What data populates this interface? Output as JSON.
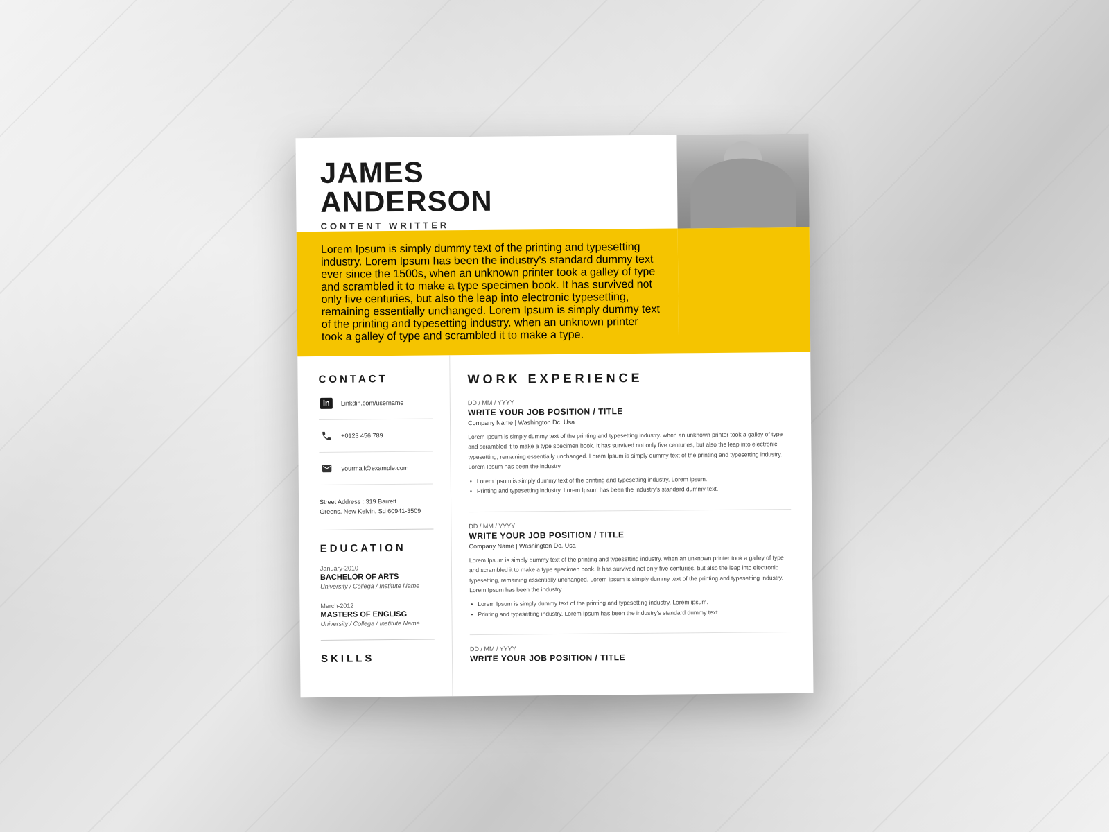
{
  "resume": {
    "name_line1": "JAMES",
    "name_line2": "ANDERSON",
    "job_title": "CONTENT WRITTER",
    "bio": "Lorem Ipsum is simply dummy text of the printing and typesetting industry. Lorem Ipsum has been the industry's standard dummy text ever since the 1500s, when an unknown printer took a galley of type and scrambled it to make a type specimen book. It has survived not only five centuries, but also the leap into electronic typesetting, remaining essentially unchanged. Lorem Ipsum is simply dummy text of the printing and typesetting industry. when an unknown printer took a galley of type and scrambled it to make a type.",
    "contact": {
      "section_label": "CONTACT",
      "linkedin": "Linkdin.com/username",
      "phone": "+0123 456 789",
      "email": "yourmail@example.com",
      "address_line1": "Street Address : 319 Barrett",
      "address_line2": "Greens, New Kelvin, Sd 60941-3509"
    },
    "education": {
      "section_label": "EDUCATION",
      "items": [
        {
          "date": "January-2010",
          "degree": "BACHELOR OF ARTS",
          "institution": "University / Collega / Institute Name"
        },
        {
          "date": "Merch-2012",
          "degree": "MASTERS OF ENGLISG",
          "institution": "University / Collega / Institute Name"
        }
      ]
    },
    "skills": {
      "section_label": "SKILLS"
    },
    "work_experience": {
      "section_label": "WORK EXPERIENCE",
      "items": [
        {
          "date": "DD / MM / YYYY",
          "title": "WRITE YOUR JOB POSITION / TITLE",
          "company": "Company Name  |  Washington Dc, Usa",
          "description": "Lorem Ipsum is simply dummy text of the printing and typesetting industry. when an unknown printer took a galley of type and scrambled it to make a type specimen book. It has survived not only five centuries, but also the leap into electronic typesetting, remaining essentially unchanged. Lorem Ipsum is simply dummy text of the printing and typesetting industry. Lorem Ipsum has been the industry.",
          "bullet1": "Lorem Ipsum is simply dummy text of the printing and typesetting industry. Lorem ipsum.",
          "bullet2": "Printing and typesetting industry. Lorem Ipsum has been the industry's standard dummy text."
        },
        {
          "date": "DD / MM / YYYY",
          "title": "WRITE YOUR JOB POSITION / TITLE",
          "company": "Company Name  |  Washington Dc, Usa",
          "description": "Lorem Ipsum is simply dummy text of the printing and typesetting industry. when an unknown printer took a galley of type and scrambled it to make a type specimen book. It has survived not only five centuries, but also the leap into electronic typesetting, remaining essentially unchanged. Lorem Ipsum is simply dummy text of the printing and typesetting industry. Lorem Ipsum has been the industry.",
          "bullet1": "Lorem Ipsum is simply dummy text of the printing and typesetting industry. Lorem ipsum.",
          "bullet2": "Printing and typesetting industry. Lorem Ipsum has been the industry's standard dummy text."
        },
        {
          "date": "DD / MM / YYYY",
          "title": "WRITE YOUR JOB POSITION / TITLE",
          "company": "",
          "description": "",
          "bullet1": "",
          "bullet2": ""
        }
      ]
    }
  }
}
